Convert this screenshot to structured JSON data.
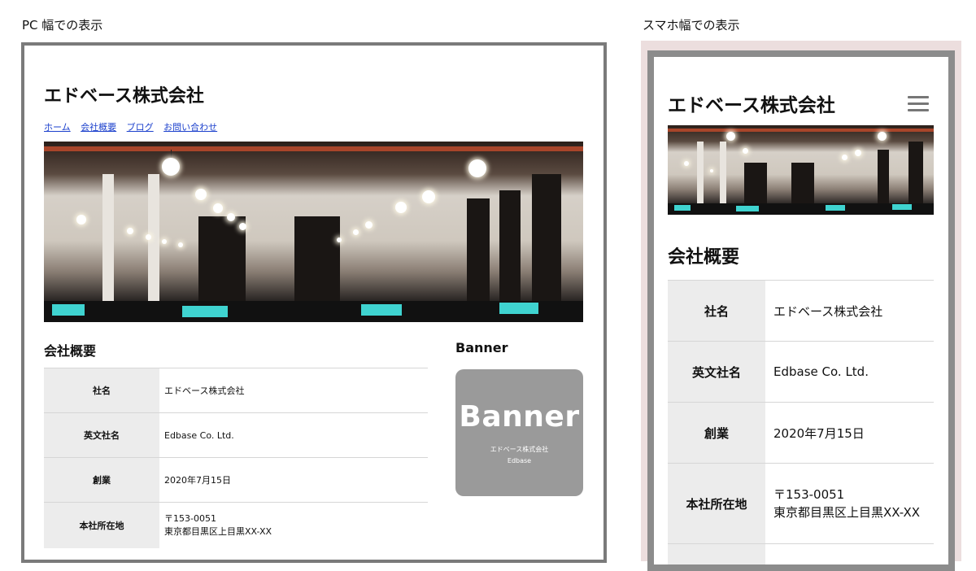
{
  "captions": {
    "pc": "PC 幅での表示",
    "sp": "スマホ幅での表示"
  },
  "site": {
    "title": "エドベース株式会社",
    "nav": [
      "ホーム",
      "会社概要",
      "ブログ",
      "お問い合わせ"
    ]
  },
  "section_title": "会社概要",
  "company_table": [
    {
      "label": "社名",
      "value": "エドベース株式会社"
    },
    {
      "label": "英文社名",
      "value": "Edbase Co. Ltd."
    },
    {
      "label": "創業",
      "value": "2020年7月15日"
    },
    {
      "label": "本社所在地",
      "value": "〒153-0051",
      "value2": "東京都目黒区上目黒XX-XX"
    }
  ],
  "sidebar": {
    "heading": "Banner",
    "banner_big": "Banner",
    "banner_line1": "エドベース株式会社",
    "banner_line2": "Edbase"
  },
  "icons": {
    "menu": "hamburger-menu-icon",
    "hero": "office-photo"
  }
}
